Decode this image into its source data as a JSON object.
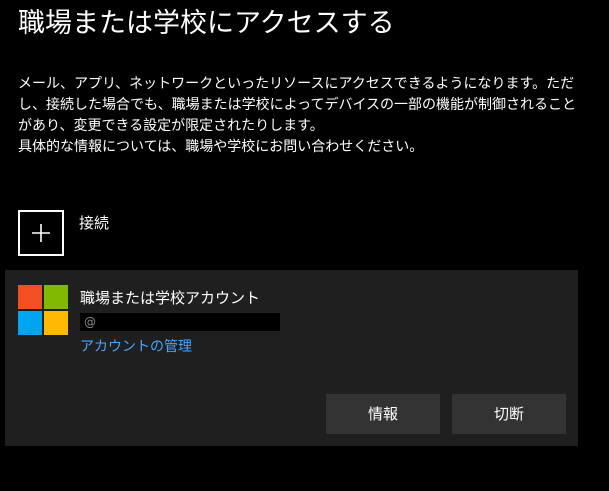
{
  "page": {
    "title": "職場または学校にアクセスする",
    "description_lines": [
      "メール、アプリ、ネットワークといったリソースにアクセスできるようになります。ただし、接続した場合でも、職場または学校によってデバイスの一部の機能が制御されることがあり、変更できる設定が限定されたりします。",
      "具体的な情報については、職場や学校にお問い合わせください。"
    ]
  },
  "connect": {
    "icon": "plus-icon",
    "label": "接続"
  },
  "account": {
    "logo": "microsoft-logo",
    "logo_colors": [
      "#f25022",
      "#7fba00",
      "#00a4ef",
      "#ffb900"
    ],
    "title": "職場または学校アカウント",
    "email_fragment": "@",
    "manage_link": "アカウントの管理",
    "buttons": {
      "info": "情報",
      "disconnect": "切断"
    }
  },
  "colors": {
    "background": "#000000",
    "card": "#1f1f1f",
    "button": "#333333",
    "link": "#4ca3ff"
  }
}
